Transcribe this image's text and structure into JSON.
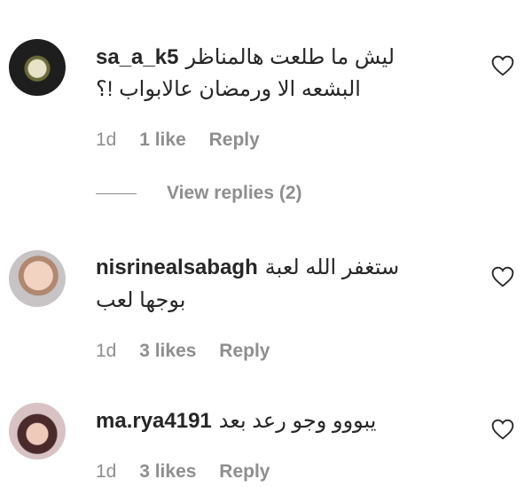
{
  "comments": [
    {
      "username": "sa_a_k5",
      "text_line1": "ليش ما طلعت هالمناظر",
      "text_line2": "البشعه الا ورمضان عالابواب !؟",
      "age": "1d",
      "likes": "1 like",
      "reply": "Reply",
      "view_replies": "View replies (2)",
      "avatar_icon": "avatar-icon"
    },
    {
      "username": "nisrinealsabagh",
      "text_line1": "ستغفر الله لعبة",
      "text_line2": "بوجها لعب",
      "age": "1d",
      "likes": "3 likes",
      "reply": "Reply",
      "avatar_icon": "avatar-icon"
    },
    {
      "username": "ma.rya4191",
      "text_line1": "يبووو وجو رعد بعد",
      "age": "1d",
      "likes": "3 likes",
      "reply": "Reply",
      "avatar_icon": "avatar-icon"
    }
  ],
  "icons": {
    "like": "heart-outline-icon"
  }
}
